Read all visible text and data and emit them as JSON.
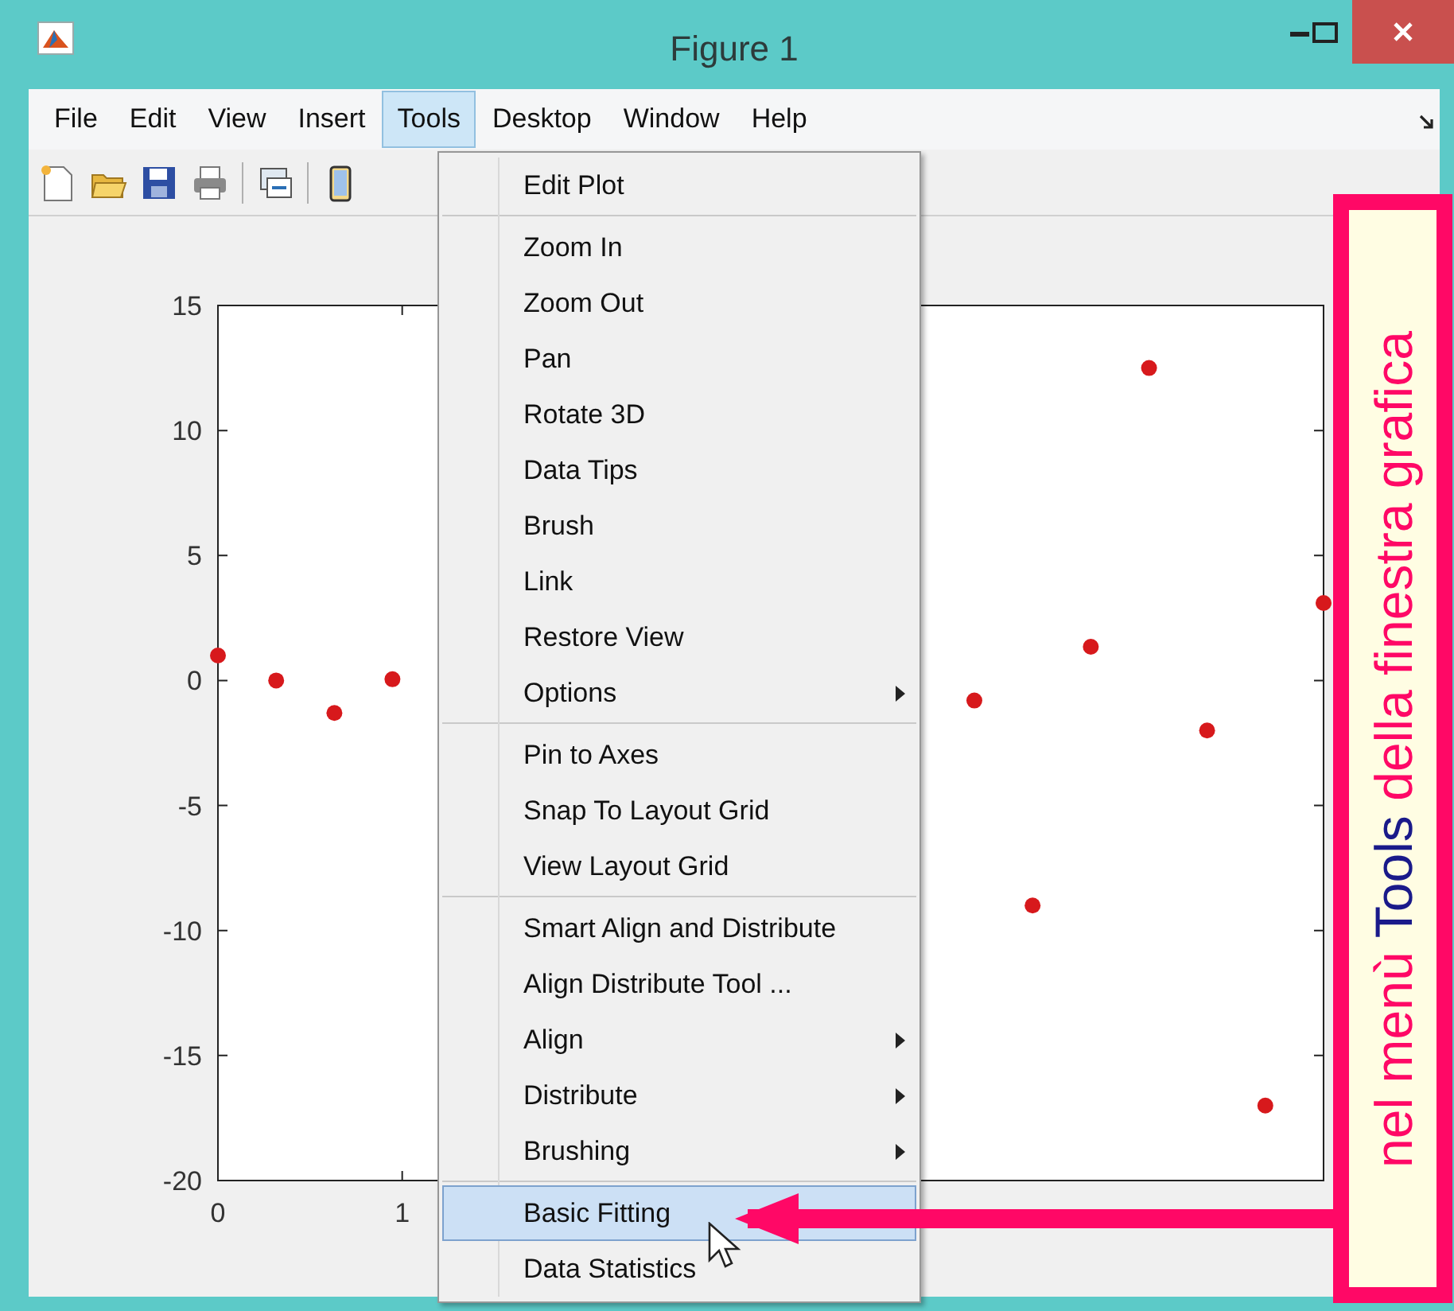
{
  "window": {
    "title": "Figure 1"
  },
  "menu_bar": [
    {
      "label": "File",
      "selected": false
    },
    {
      "label": "Edit",
      "selected": false
    },
    {
      "label": "View",
      "selected": false
    },
    {
      "label": "Insert",
      "selected": false
    },
    {
      "label": "Tools",
      "selected": true
    },
    {
      "label": "Desktop",
      "selected": false
    },
    {
      "label": "Window",
      "selected": false
    },
    {
      "label": "Help",
      "selected": false
    }
  ],
  "toolbar": [
    {
      "kind": "new"
    },
    {
      "kind": "open"
    },
    {
      "kind": "save"
    },
    {
      "kind": "print"
    },
    {
      "kind": "separator"
    },
    {
      "kind": "link"
    },
    {
      "kind": "separator"
    },
    {
      "kind": "panel"
    }
  ],
  "tools_menu": {
    "groups": [
      [
        {
          "label": "Edit Plot",
          "has_submenu": false,
          "selected": false
        }
      ],
      [
        {
          "label": "Zoom In",
          "has_submenu": false,
          "selected": false
        },
        {
          "label": "Zoom Out",
          "has_submenu": false,
          "selected": false
        },
        {
          "label": "Pan",
          "has_submenu": false,
          "selected": false
        },
        {
          "label": "Rotate 3D",
          "has_submenu": false,
          "selected": false
        },
        {
          "label": "Data Tips",
          "has_submenu": false,
          "selected": false
        },
        {
          "label": "Brush",
          "has_submenu": false,
          "selected": false
        },
        {
          "label": "Link",
          "has_submenu": false,
          "selected": false
        },
        {
          "label": "Restore View",
          "has_submenu": false,
          "selected": false
        },
        {
          "label": "Options",
          "has_submenu": true,
          "selected": false
        }
      ],
      [
        {
          "label": "Pin to Axes",
          "has_submenu": false,
          "selected": false
        },
        {
          "label": "Snap To Layout Grid",
          "has_submenu": false,
          "selected": false
        },
        {
          "label": "View Layout Grid",
          "has_submenu": false,
          "selected": false
        }
      ],
      [
        {
          "label": "Smart Align and Distribute",
          "has_submenu": false,
          "selected": false
        },
        {
          "label": "Align Distribute Tool ...",
          "has_submenu": false,
          "selected": false
        },
        {
          "label": "Align",
          "has_submenu": true,
          "selected": false
        },
        {
          "label": "Distribute",
          "has_submenu": true,
          "selected": false
        },
        {
          "label": "Brushing",
          "has_submenu": true,
          "selected": false
        }
      ],
      [
        {
          "label": "Basic Fitting",
          "has_submenu": false,
          "selected": true
        },
        {
          "label": "Data Statistics",
          "has_submenu": false,
          "selected": false
        }
      ]
    ]
  },
  "plot": {
    "chart_data": {
      "type": "scatter",
      "x": [
        0,
        0.316,
        0.632,
        0.947,
        4.105,
        4.421,
        4.737,
        5.053,
        5.368,
        5.684,
        6
      ],
      "series": [
        {
          "color": "#d7191c",
          "values": [
            1.0,
            0.0,
            -1.3,
            0.05,
            -0.8,
            -9.0,
            1.35,
            12.5,
            -2.0,
            -17.0,
            3.1
          ]
        }
      ],
      "xlim": [
        0,
        6
      ],
      "ylim": [
        -20,
        15
      ],
      "xticks": [
        0,
        1
      ],
      "yticks": [
        -20,
        -15,
        -10,
        -5,
        0,
        5,
        10,
        15
      ]
    }
  },
  "annotation": {
    "parts": [
      {
        "text": "nel menù ",
        "kind": "plain"
      },
      {
        "text": "Tools",
        "kind": "highlight"
      },
      {
        "text": " della finestra grafica",
        "kind": "plain"
      }
    ]
  }
}
